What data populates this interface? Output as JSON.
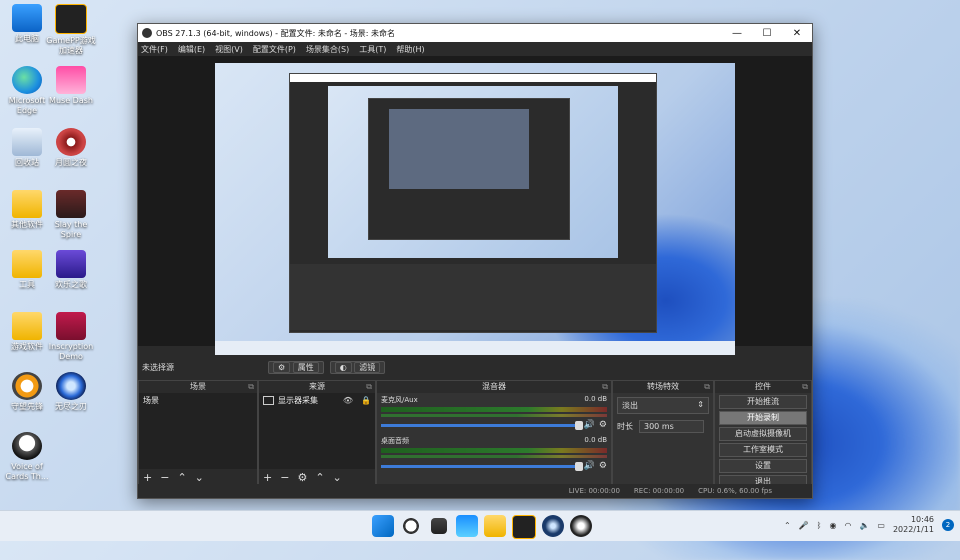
{
  "desktop": {
    "icons": [
      {
        "label": "此电脑"
      },
      {
        "label": "Microsoft Edge"
      },
      {
        "label": "回收站"
      },
      {
        "label": "其他软件"
      },
      {
        "label": "工具"
      },
      {
        "label": "游戏软件"
      },
      {
        "label": "守望先锋"
      },
      {
        "label": "Voice of Cards Th..."
      },
      {
        "label": "GamePP游戏加速器"
      },
      {
        "label": "Muse Dash"
      },
      {
        "label": "月圆之夜"
      },
      {
        "label": "Slay the Spire"
      },
      {
        "label": "欢乐之歌"
      },
      {
        "label": "Inscryption Demo"
      },
      {
        "label": "无尽之刃"
      }
    ]
  },
  "obs": {
    "title": "OBS 27.1.3 (64-bit, windows) - 配置文件: 未命名 - 场景: 未命名",
    "menu": [
      "文件(F)",
      "编辑(E)",
      "视图(V)",
      "配置文件(P)",
      "场景集合(S)",
      "工具(T)",
      "帮助(H)"
    ],
    "scenebar": {
      "label": "未选择源",
      "properties": "属性",
      "filters": "滤镜"
    },
    "docks": {
      "scenes": {
        "title": "场景",
        "items": [
          "场景"
        ]
      },
      "sources": {
        "title": "来源",
        "items": [
          "显示器采集"
        ]
      },
      "mixer": {
        "title": "混音器",
        "tracks": [
          {
            "name": "麦克风/Aux",
            "db": "0.0 dB"
          },
          {
            "name": "桌面音频",
            "db": "0.0 dB"
          }
        ]
      },
      "transitions": {
        "title": "转场特效",
        "selected": "淡出",
        "duration_label": "时长",
        "duration_value": "300 ms"
      },
      "controls": {
        "title": "控件",
        "buttons": [
          "开始推流",
          "开始录制",
          "启动虚拟摄像机",
          "工作室模式",
          "设置",
          "退出"
        ]
      }
    },
    "status": {
      "live": "LIVE: 00:00:00",
      "rec": "REC: 00:00:00",
      "cpu": "CPU: 0.6%, 60.00 fps"
    }
  },
  "taskbar": {
    "time": "10:46",
    "date": "2022/1/11",
    "notif_count": "2"
  }
}
